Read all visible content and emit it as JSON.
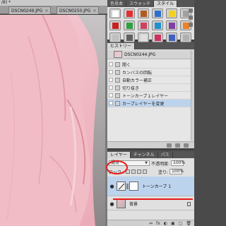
{
  "document": {
    "title": "/8) *",
    "tabs": [
      {
        "label": "DSCN0249.JPG",
        "close": "×"
      },
      {
        "label": "DSCN0250.JPG",
        "close": "×"
      }
    ]
  },
  "swatches_panel": {
    "tabs": [
      {
        "label": "色見本"
      },
      {
        "label": "スウォッチ"
      },
      {
        "label": "スタイル"
      }
    ],
    "colors": [
      "#ffffff",
      "#e03030",
      "#b05a20",
      "#2d6fd0",
      "#f0d020",
      "#a0a0a0",
      "#c82020",
      "#30a040",
      "#d04060",
      "#2090d0",
      "#8040a0",
      "#f08020",
      "#c0c0c0",
      "#606060",
      "#e0e0e0",
      "#d03060",
      "#4060c0",
      "#b0b0b0"
    ]
  },
  "history_panel": {
    "title": "ヒストリー",
    "snapshot_label": "DSCN0244.JPG",
    "items": [
      {
        "label": "開く"
      },
      {
        "label": "カンバスの回転"
      },
      {
        "label": "自動カラー補正"
      },
      {
        "label": "切り抜き"
      },
      {
        "label": "トーンカーブ１レイヤー"
      },
      {
        "label": "カーブレイヤーを変更"
      }
    ],
    "selected_index": 5
  },
  "layers_panel": {
    "tabs": [
      {
        "label": "レイヤー"
      },
      {
        "label": "チャンネル"
      },
      {
        "label": "パス"
      }
    ],
    "blend_mode": "通常",
    "opacity_label": "不透明度:",
    "opacity_value": "100%",
    "lock_label": "ロック :",
    "fill_label": "塗り:",
    "fill_value": "100%",
    "layers": [
      {
        "name": "トーンカーブ 1",
        "selected": true
      },
      {
        "name": "背景",
        "selected": false
      }
    ],
    "bottom_buttons": [
      "⇔",
      "fx",
      "◐",
      "▣",
      "▢",
      "🗑"
    ]
  },
  "colors": {
    "annotation": "#e81a1a",
    "selection": "#bcd3ee"
  }
}
